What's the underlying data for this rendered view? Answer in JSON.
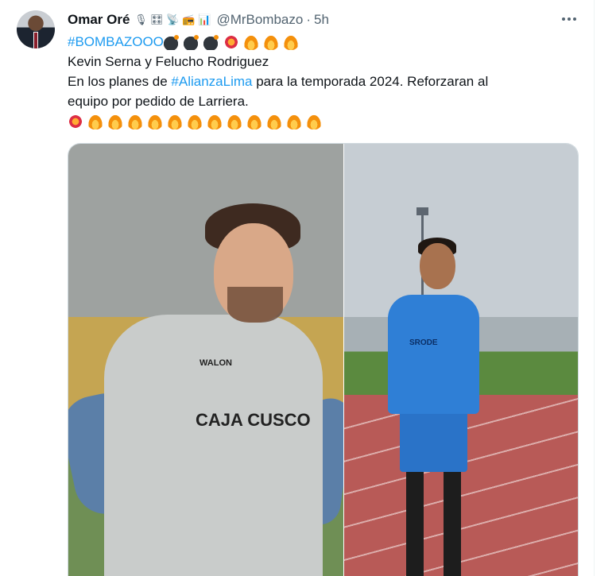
{
  "author": {
    "name": "Omar Oré",
    "handle": "@MrBombazo",
    "separator": "·",
    "time": "5h",
    "emoji_icons": [
      "microphone-icon",
      "control-knobs-icon",
      "satellite-antenna-icon",
      "radio-icon",
      "bar-chart-icon"
    ]
  },
  "tweet": {
    "hashtag_main": "#BOMBAZOOO",
    "line2": "Kevin Serna y Felucho Rodriguez",
    "line3_pre": "En los planes de ",
    "line3_tag": "#AlianzaLima",
    "line3_post": " para la temporada 2024. Reforzaran al",
    "line4": "equipo por pedido de Larriera.",
    "line1_icons": [
      "bomb-icon",
      "bomb-icon",
      "bomb-icon",
      "collision-icon",
      "fire-icon",
      "fire-icon",
      "fire-icon"
    ],
    "line5_icons": [
      "collision-icon",
      "fire-icon",
      "fire-icon",
      "fire-icon",
      "fire-icon",
      "fire-icon",
      "fire-icon",
      "fire-icon",
      "fire-icon",
      "fire-icon",
      "fire-icon",
      "fire-icon",
      "fire-icon"
    ]
  },
  "media": {
    "left_jersey_brand": "WALON",
    "left_jersey_sponsor": "CAJA CUSCO",
    "right_jersey_brand": "SRODE"
  },
  "colors": {
    "link": "#1d9bf0",
    "text": "#0f1419",
    "secondary": "#536471"
  }
}
